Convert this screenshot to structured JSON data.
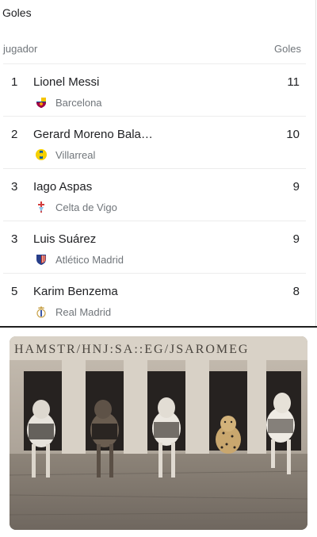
{
  "title": "Goles",
  "header": {
    "left": "jugador",
    "right": "Goles"
  },
  "rows": [
    {
      "rank": "1",
      "name": "Lionel Messi",
      "team": "Barcelona",
      "goals": "11",
      "crest": "barcelona-crest-icon"
    },
    {
      "rank": "2",
      "name": "Gerard Moreno Bala…",
      "team": "Villarreal",
      "goals": "10",
      "crest": "villarreal-crest-icon"
    },
    {
      "rank": "3",
      "name": "Iago Aspas",
      "team": "Celta de Vigo",
      "goals": "9",
      "crest": "celta-crest-icon"
    },
    {
      "rank": "3",
      "name": "Luis Suárez",
      "team": "Atlético Madrid",
      "goals": "9",
      "crest": "atletico-crest-icon"
    },
    {
      "rank": "5",
      "name": "Karim Benzema",
      "team": "Real Madrid",
      "goals": "8",
      "crest": "realmadrid-crest-icon"
    }
  ],
  "colors": {
    "barcelona": "#a50044",
    "barcelona_blue": "#004d98",
    "villarreal": "#f5d000",
    "celta": "#8ec5ea",
    "atletico": "#cb3524",
    "atletico_blue": "#273e8a",
    "realmadrid": "#c8a24a"
  }
}
